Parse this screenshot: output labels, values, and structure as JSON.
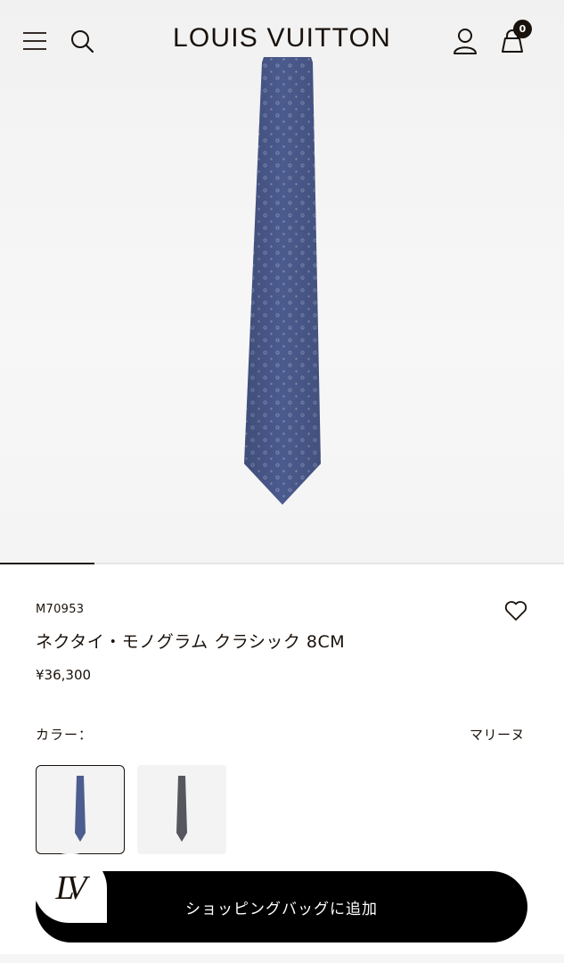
{
  "header": {
    "brand": "LOUIS VUITTON",
    "bag_count": "0"
  },
  "product": {
    "sku": "M70953",
    "title": "ネクタイ・モノグラム クラシック 8CM",
    "price": "¥36,300",
    "color_label": "カラー：",
    "color_value": "マリーヌ",
    "add_to_bag_label": "ショッピングバッグに追加",
    "image_count": 6,
    "current_image_index": 1,
    "swatches": [
      {
        "color": "#4a5a8c",
        "selected": true
      },
      {
        "color": "#55555c",
        "selected": false
      }
    ]
  },
  "badge": {
    "logo": "LV"
  },
  "colors": {
    "text": "#19110b",
    "tie_navy": "#4a5a8c",
    "tie_gray": "#55555c",
    "button": "#000000"
  }
}
